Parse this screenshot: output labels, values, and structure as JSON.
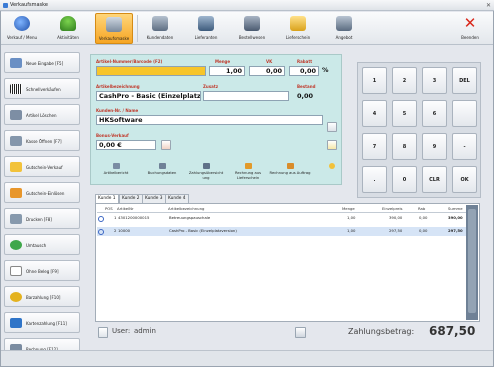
{
  "window": {
    "title": "Verkaufsmaske",
    "close": "✕"
  },
  "colors": {
    "accent": "#f6a523",
    "panel": "#cbe9e8",
    "label": "#c0392b",
    "brand": "#3a7bd5"
  },
  "toolbar": [
    {
      "label": "Verkauf / Menu",
      "icon": "globe-icon"
    },
    {
      "label": "Aktivitäten",
      "icon": "plant-icon"
    },
    {
      "label": "Verkaufsmaske",
      "icon": "register-icon",
      "active": true
    },
    {
      "label": "Kundendaten",
      "icon": "people-icon"
    },
    {
      "label": "Lieferanten",
      "icon": "truck-icon"
    },
    {
      "label": "Bestellwesen",
      "icon": "person-order-icon"
    },
    {
      "label": "Lieferschein",
      "icon": "delivery-note-icon"
    },
    {
      "label": "Angebot",
      "icon": "offer-icon"
    },
    {
      "label": "Beenden",
      "icon": "close-icon"
    }
  ],
  "sidebar": [
    {
      "label": "Neue Eingabe [F5]",
      "icon": "new-entry-icon"
    },
    {
      "label": "Schnellverkäufen",
      "icon": "barcode-icon"
    },
    {
      "label": "Artikel Löschen",
      "icon": "delete-article-icon"
    },
    {
      "label": "Kasse Öffnen [F7]",
      "icon": "cash-drawer-icon"
    },
    {
      "label": "Gutschein-Verkauf",
      "icon": "voucher-icon"
    },
    {
      "label": "Gutschein-Einlösen",
      "icon": "voucher-redeem-icon"
    },
    {
      "label": "Drucken [F8]",
      "icon": "print-icon"
    },
    {
      "label": "Umtausch",
      "icon": "exchange-icon"
    },
    {
      "label": "Ohne Beleg [F9]",
      "icon": "no-receipt-icon"
    },
    {
      "label": "Barzahlung [F10]",
      "icon": "cash-icon"
    },
    {
      "label": "Kartenzahlung [F11]",
      "icon": "card-icon"
    },
    {
      "label": "Rechnung [F12]",
      "icon": "invoice-icon"
    }
  ],
  "form": {
    "article_label": "Artikel-Nummer/Barcode (F2)",
    "article_value": "",
    "menge_label": "Menge",
    "menge_value": "1,00",
    "vk_label": "VK",
    "vk_value": "0,00",
    "rabatt_label": "Rabatt",
    "rabatt_value": "0,00",
    "percent": "%",
    "desc_label": "Artikelbezeichnung",
    "desc_value": "CashPro - Basic (Einzelplatzver",
    "zusatz_label": "Zusatz",
    "zusatz_value": "",
    "bestand_label": "Bestand",
    "bestand_value": "0,00",
    "kunde_label": "Kunden-Nr. / Name",
    "kunde_value": "HKSoftware",
    "bonus_label": "Bonus-Verkauf",
    "bonus_value": "0,00 €"
  },
  "actions": [
    {
      "label": "Artikelbericht",
      "icon": "report-icon"
    },
    {
      "label": "Buchungsdaten",
      "icon": "booking-icon"
    },
    {
      "label": "Zahlungsübersicht ung",
      "icon": "payment-overview-icon"
    },
    {
      "label": "Rechnung aus Lieferschein",
      "icon": "invoice-from-delivery-icon"
    },
    {
      "label": "Rechnung aus Auftrag",
      "icon": "invoice-from-order-icon"
    }
  ],
  "keypad": [
    "1",
    "2",
    "3",
    "DEL",
    "4",
    "5",
    "6",
    "",
    "7",
    "8",
    "9",
    "-",
    ".",
    "0",
    "CLR",
    "OK"
  ],
  "tabs": [
    "Kunde 1",
    "Kunde 2",
    "Kunde 3",
    "Kunde 4"
  ],
  "table": {
    "headers": [
      "POS",
      "ArtikelNr",
      "Artikelbezeichnung",
      "Menge",
      "Einzelpreis",
      "Rab",
      "Summe"
    ],
    "rows": [
      {
        "pos": "1",
        "nr": "4301200000015",
        "desc": "Betreuungspauschale",
        "menge": "1,00",
        "preis": "390,00",
        "rab": "0,00",
        "summe": "390,00"
      },
      {
        "pos": "2",
        "nr": "10000",
        "desc": "CashPro - Basic (Einzelplatzversion)",
        "menge": "1,00",
        "preis": "297,50",
        "rab": "0,00",
        "summe": "297,50"
      }
    ]
  },
  "footer": {
    "user_label": "User:",
    "user_value": "admin",
    "total_label": "Zahlungsbetrag:",
    "total_value": "687,50"
  }
}
